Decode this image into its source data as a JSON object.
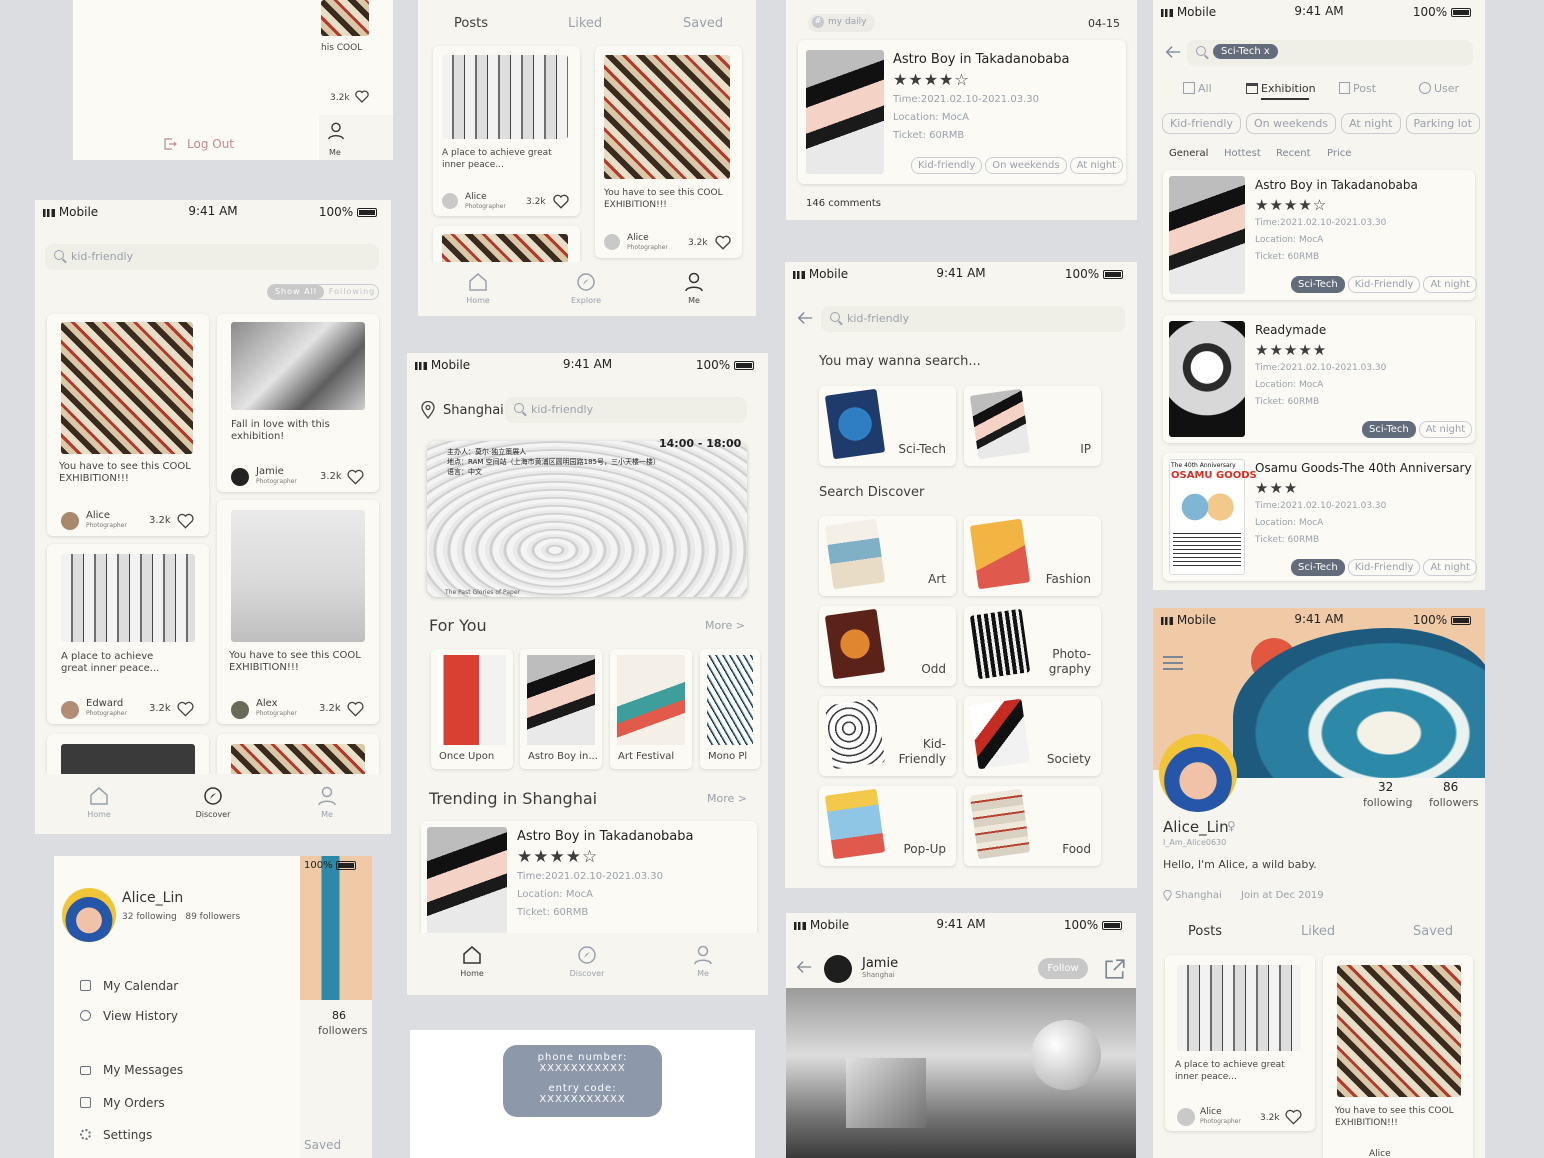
{
  "colors": {
    "cream": "#f6f5ef",
    "slate": "#636c7a",
    "muted": "#9aa1ad",
    "text": "#3d3d3d"
  },
  "status": {
    "carrier": "Mobile",
    "time": "9:41 AM",
    "battery": "100%"
  },
  "s1": {
    "caption": "his COOL",
    "likes": "3.2k",
    "logout": "Log Out",
    "me": "Me"
  },
  "s2": {
    "tabs": [
      "Posts",
      "Liked",
      "Saved"
    ],
    "cards": [
      {
        "text": "A place to achieve great inner peace...",
        "user": "Alice",
        "role": "Photographer",
        "likes": "3.2k"
      },
      {
        "text": "You have to see this COOL EXHIBITION!!!",
        "user": "Alice",
        "role": "Photographer",
        "likes": "3.2k"
      }
    ],
    "nav": [
      "Home",
      "Explore",
      "Me"
    ]
  },
  "s3": {
    "tag": "my daily",
    "date": "04-15",
    "title": "Astro Boy in Takadanobaba",
    "time": "Time:2021.02.10-2021.03.30",
    "location": "Location: MocA",
    "ticket": "Ticket: 60RMB",
    "tags": [
      "Kid-friendly",
      "On weekends",
      "At night"
    ],
    "comments": "146 comments"
  },
  "s4": {
    "query": "Sci-Tech",
    "clear": "x",
    "filters": [
      "All",
      "Exhibition",
      "Post",
      "User"
    ],
    "tags": [
      "Kid-friendly",
      "On weekends",
      "At night",
      "Parking lot"
    ],
    "sort": [
      "General",
      "Hottest",
      "Recent",
      "Price"
    ],
    "results": [
      {
        "title": "Astro Boy in Takadanobaba",
        "stars": "★★★★☆",
        "time": "Time:2021.02.10-2021.03.30",
        "location": "Location: MocA",
        "ticket": "Ticket: 60RMB",
        "tags": [
          "Sci-Tech",
          "Kid-Friendly",
          "At night"
        ]
      },
      {
        "title": "Readymade",
        "stars": "★★★★★",
        "time": "Time:2021.02.10-2021.03.30",
        "location": "Location: MocA",
        "ticket": "Ticket: 60RMB",
        "tags": [
          "Sci-Tech",
          "At night"
        ]
      },
      {
        "title": "Osamu Goods-The 40th Anniversary",
        "stars": "★★★",
        "time": "Time:2021.02.10-2021.03.30",
        "location": "Location: MocA",
        "ticket": "Ticket: 60RMB",
        "tags": [
          "Sci-Tech",
          "Kid-Friendly",
          "At night"
        ],
        "poster_top": "The 40th Anniversary",
        "poster_title": "OSAMU GOODS"
      }
    ]
  },
  "s5": {
    "search": "kid-friendly",
    "toggle": [
      "Show All",
      "Following"
    ],
    "cards": [
      {
        "text": "You have to see this COOL EXHIBITION!!!",
        "user": "Alice",
        "role": "Photographer",
        "likes": "3.2k"
      },
      {
        "text": "Fall in love with this exhibition!",
        "user": "Jamie",
        "role": "Photographer",
        "likes": "3.2k"
      },
      {
        "text": "A place to achieve great inner peace...",
        "user": "Edward",
        "role": "Photographer",
        "likes": "3.2k"
      },
      {
        "text": "You have to see this COOL EXHIBITION!!!",
        "user": "Alex",
        "role": "Photographer",
        "likes": "3.2k"
      }
    ],
    "nav": [
      "Home",
      "Discover",
      "Me"
    ]
  },
  "s6": {
    "city": "Shanghai",
    "search": "kid-friendly",
    "banner_time": "14:00 - 18:00",
    "banner_lines": [
      "主办人：莫尔·独立策展人",
      "地点：RAM 空间站（上海市黄浦区圆明园路185号，三小天楼一楼）",
      "语言：中文"
    ],
    "banner_caption": "The Past Glories of Paper",
    "for_you": "For You",
    "more": "More >",
    "items": [
      "Once Upon",
      "Astro Boy in...",
      "Art Festival",
      "Mono Pl"
    ],
    "trending": "Trending in Shanghai",
    "tr": {
      "title": "Astro Boy in Takadanobaba",
      "time": "Time:2021.02.10-2021.03.30",
      "location": "Location: MocA",
      "ticket": "Ticket: 60RMB"
    },
    "nav": [
      "Home",
      "Discover",
      "Me"
    ]
  },
  "s7": {
    "search": "kid-friendly",
    "wanna": "You may wanna search...",
    "sugg": [
      "Sci-Tech",
      "IP"
    ],
    "discover": "Search Discover",
    "cats": [
      [
        "Art"
      ],
      [
        "Fashion"
      ],
      [
        "Odd"
      ],
      [
        "Photo-",
        "graphy"
      ],
      [
        "Kid-",
        "Friendly"
      ],
      [
        "Society"
      ],
      [
        "Pop-Up"
      ],
      [
        "Food"
      ]
    ]
  },
  "s8": {
    "name": "Alice_Lin",
    "handle": "I_Am_Alice0630",
    "following_n": "32",
    "following": "following",
    "followers_n": "86",
    "followers": "followers",
    "bio": "Hello, I'm Alice, a wild baby.",
    "city": "Shanghai",
    "joined": "Join at Dec 2019",
    "tabs": [
      "Posts",
      "Liked",
      "Saved"
    ],
    "cards": [
      {
        "text": "A place to achieve great inner peace...",
        "user": "Alice",
        "role": "Photographer",
        "likes": "3.2k"
      },
      {
        "text": "You have to see this COOL EXHIBITION!!!",
        "user": "Alice"
      }
    ]
  },
  "s9": {
    "name": "Alice_Lin",
    "stats": "32 following   89 followers",
    "menu": [
      "My Calendar",
      "View History",
      "My Messages",
      "My Orders",
      "Settings"
    ],
    "followers_n": "86",
    "followers": "followers",
    "saved": "Saved",
    "battery": "100%"
  },
  "s10": {
    "phone_label": "phone number:",
    "phone": "XXXXXXXXXXX",
    "entry_label": "entry code:",
    "entry": "XXXXXXXXXXX"
  },
  "s11": {
    "name": "Jamie",
    "city": "Shanghai",
    "follow": "Follow"
  }
}
